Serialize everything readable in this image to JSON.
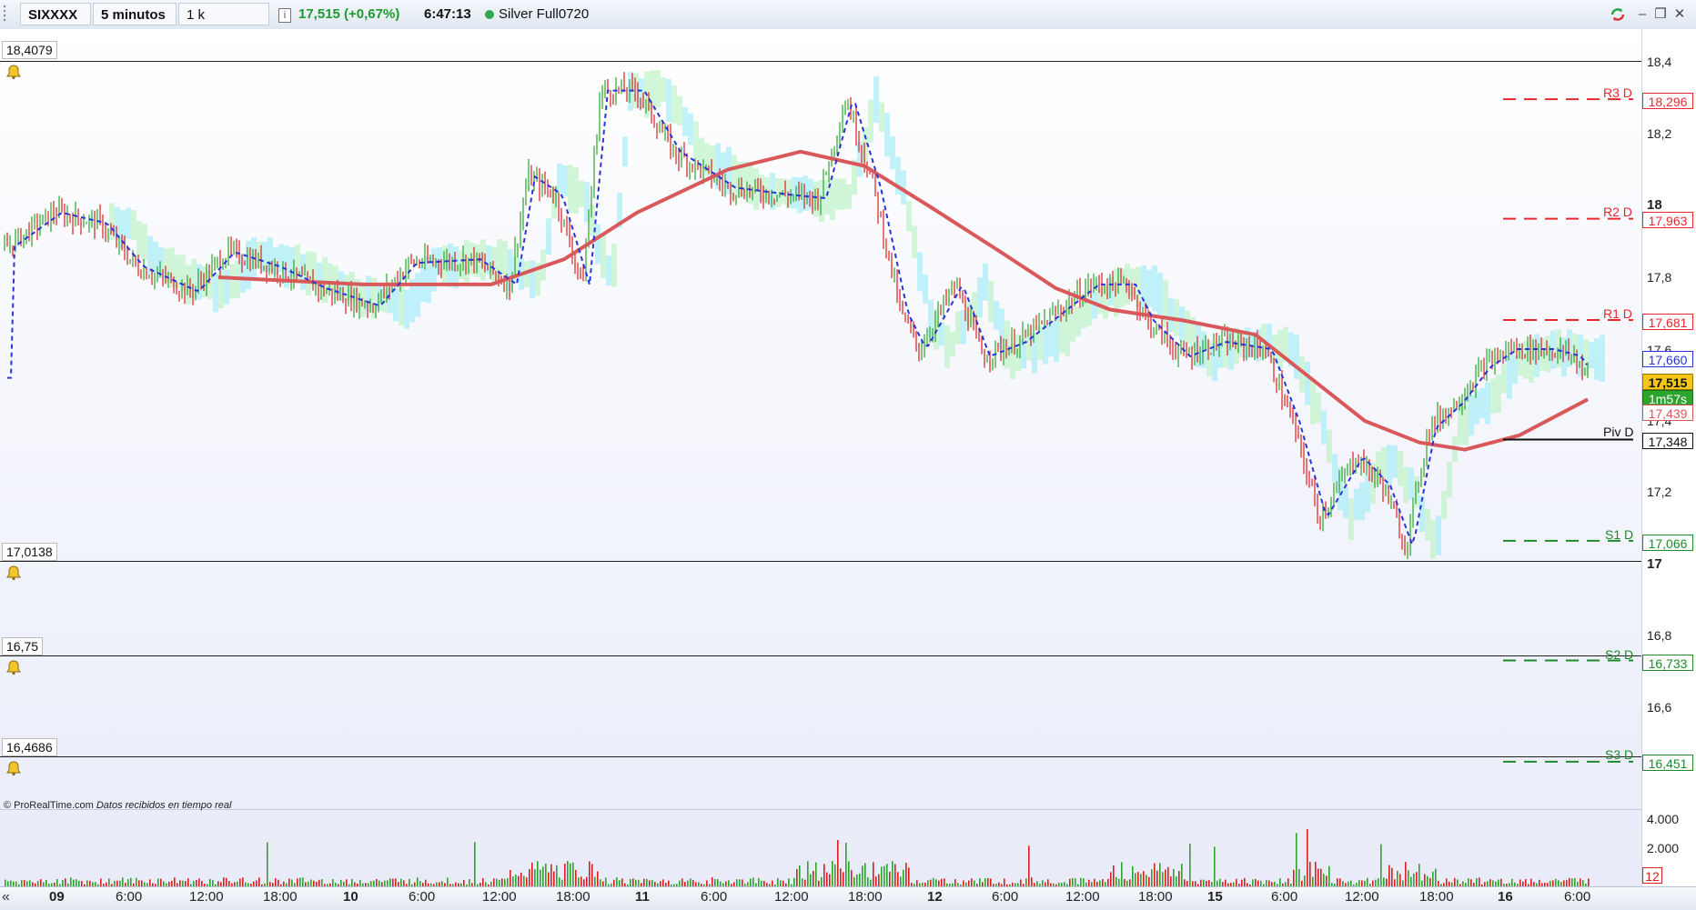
{
  "toolbar": {
    "instrument": "SIXXXX",
    "timeframe": "5 minutos",
    "units": "1 k unidades",
    "info_icon": "info-icon",
    "price_change": "17,515 (+0,67%)",
    "time": "6:47:13",
    "status_color": "#2fa84f",
    "contract": "Silver Full0720"
  },
  "levels": {
    "top": "18,4079",
    "mid1": "17,0138",
    "mid2": "16,75",
    "mid3": "16,4686"
  },
  "price_axis": {
    "ticks": [
      "18,4",
      "18,2",
      "18",
      "17,8",
      "17,6",
      "17,4",
      "17,2",
      "17",
      "16,8",
      "16,6"
    ],
    "major": [
      "18",
      "17"
    ]
  },
  "pivots": [
    {
      "name": "R3 D",
      "value": "18,296",
      "color": "#e8282f"
    },
    {
      "name": "R2 D",
      "value": "17,963",
      "color": "#e8282f"
    },
    {
      "name": "R1 D",
      "value": "17,681",
      "color": "#e8282f"
    },
    {
      "name": "Piv D",
      "value": "17,348",
      "color": "#111111"
    },
    {
      "name": "S1 D",
      "value": "17,066",
      "color": "#1f8a2b"
    },
    {
      "name": "S2 D",
      "value": "16,733",
      "color": "#1f8a2b"
    },
    {
      "name": "S3 D",
      "value": "16,451",
      "color": "#1f8a2b"
    }
  ],
  "current": {
    "price": "17,515",
    "countdown": "1m57s",
    "ma_partial": "17,660",
    "ma_lower": "17,439"
  },
  "volume_axis": [
    "4.000",
    "2.000",
    "12"
  ],
  "time_axis": [
    {
      "label": "09",
      "day": true
    },
    {
      "label": "6:00",
      "day": false
    },
    {
      "label": "12:00",
      "day": false
    },
    {
      "label": "18:00",
      "day": false
    },
    {
      "label": "10",
      "day": true
    },
    {
      "label": "6:00",
      "day": false
    },
    {
      "label": "12:00",
      "day": false
    },
    {
      "label": "18:00",
      "day": false
    },
    {
      "label": "11",
      "day": true
    },
    {
      "label": "6:00",
      "day": false
    },
    {
      "label": "12:00",
      "day": false
    },
    {
      "label": "18:00",
      "day": false
    },
    {
      "label": "12",
      "day": true
    },
    {
      "label": "6:00",
      "day": false
    },
    {
      "label": "12:00",
      "day": false
    },
    {
      "label": "18:00",
      "day": false
    },
    {
      "label": "15",
      "day": true
    },
    {
      "label": "6:00",
      "day": false
    },
    {
      "label": "12:00",
      "day": false
    },
    {
      "label": "18:00",
      "day": false
    },
    {
      "label": "16",
      "day": true
    },
    {
      "label": "6:00",
      "day": false
    }
  ],
  "credit": {
    "site": "© ProRealTime.com",
    "note": "Datos recibidos en tiempo real"
  },
  "colors": {
    "candle_up": "#2ca52c",
    "candle_down": "#d92020",
    "ma_thick": "#d9595b",
    "ma_dash": "#2a34d8",
    "cloud_blue": "#a8ecf6",
    "cloud_green": "#bff2c8"
  }
}
